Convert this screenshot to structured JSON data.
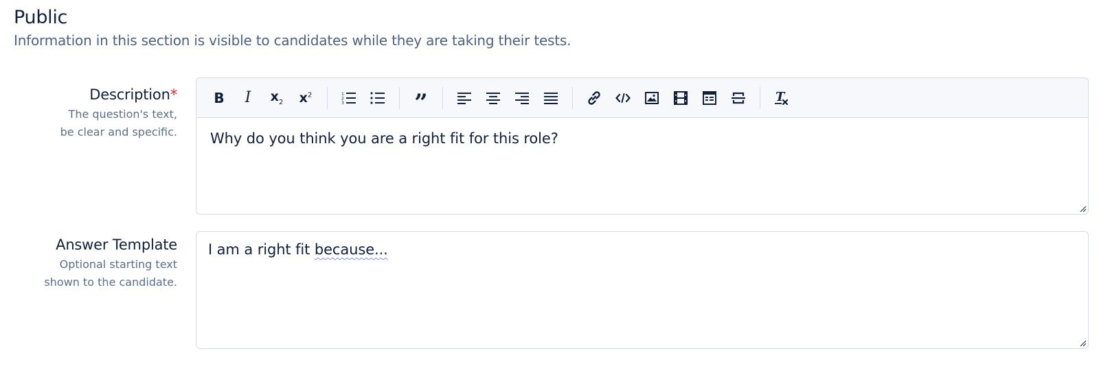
{
  "section": {
    "title": "Public",
    "subtitle": "Information in this section is visible to candidates while they are taking their tests."
  },
  "description_field": {
    "label": "Description",
    "required_mark": "*",
    "help_line1": "The question's text,",
    "help_line2": "be clear and specific.",
    "value": "Why do you think you are a right fit for this role?"
  },
  "answer_field": {
    "label": "Answer Template",
    "help_line1": "Optional starting text",
    "help_line2": "shown to the candidate.",
    "value_prefix": "I am a right fit ",
    "value_flagged": "because..."
  },
  "toolbar": {
    "bold_label": "B",
    "italic_label": "I",
    "subscript_label": "x",
    "subscript_mark": "2",
    "superscript_label": "x",
    "superscript_mark": "2",
    "quote_label": "”",
    "icons": [
      "bold-icon",
      "italic-icon",
      "subscript-icon",
      "superscript-icon",
      "ordered-list-icon",
      "bullet-list-icon",
      "blockquote-icon",
      "align-left-icon",
      "align-center-icon",
      "align-right-icon",
      "align-justify-icon",
      "link-icon",
      "code-icon",
      "image-icon",
      "video-icon",
      "table-icon",
      "horizontal-rule-icon",
      "clear-format-icon"
    ]
  },
  "colors": {
    "text": "#0f1f3d",
    "muted": "#4a6282",
    "required": "#e02424",
    "border": "#d3dbe6",
    "toolbar_bg": "#f6f8fb",
    "spell_underline": "#8a8cf0"
  }
}
